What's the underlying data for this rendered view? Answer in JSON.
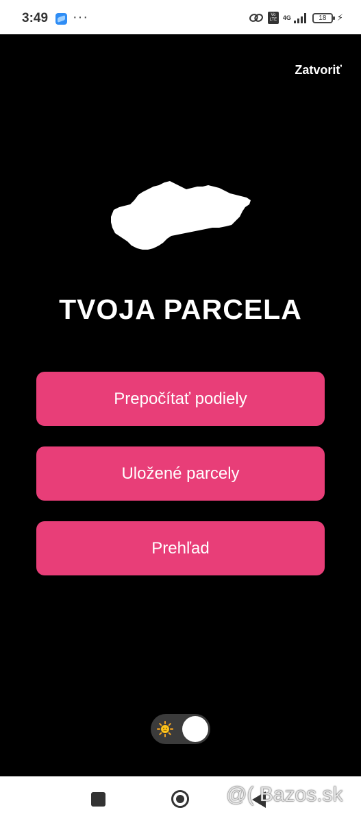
{
  "status_bar": {
    "time": "3:49",
    "more": "···",
    "volte": "Vo LTE",
    "network": "4G",
    "battery": "18"
  },
  "header": {
    "close_label": "Zatvoriť"
  },
  "app": {
    "title": "TVOJA PARCELA"
  },
  "menu": {
    "items": [
      {
        "label": "Prepočítať podiely"
      },
      {
        "label": "Uložené parcely"
      },
      {
        "label": "Prehľad"
      }
    ]
  },
  "theme_toggle": {
    "icon": "sun-icon",
    "state": "on"
  },
  "watermark": {
    "text": "@( Bazos.sk"
  },
  "colors": {
    "background": "#000000",
    "button": "#e83e78",
    "text": "#ffffff",
    "toggle_track": "#3b3b3b"
  }
}
